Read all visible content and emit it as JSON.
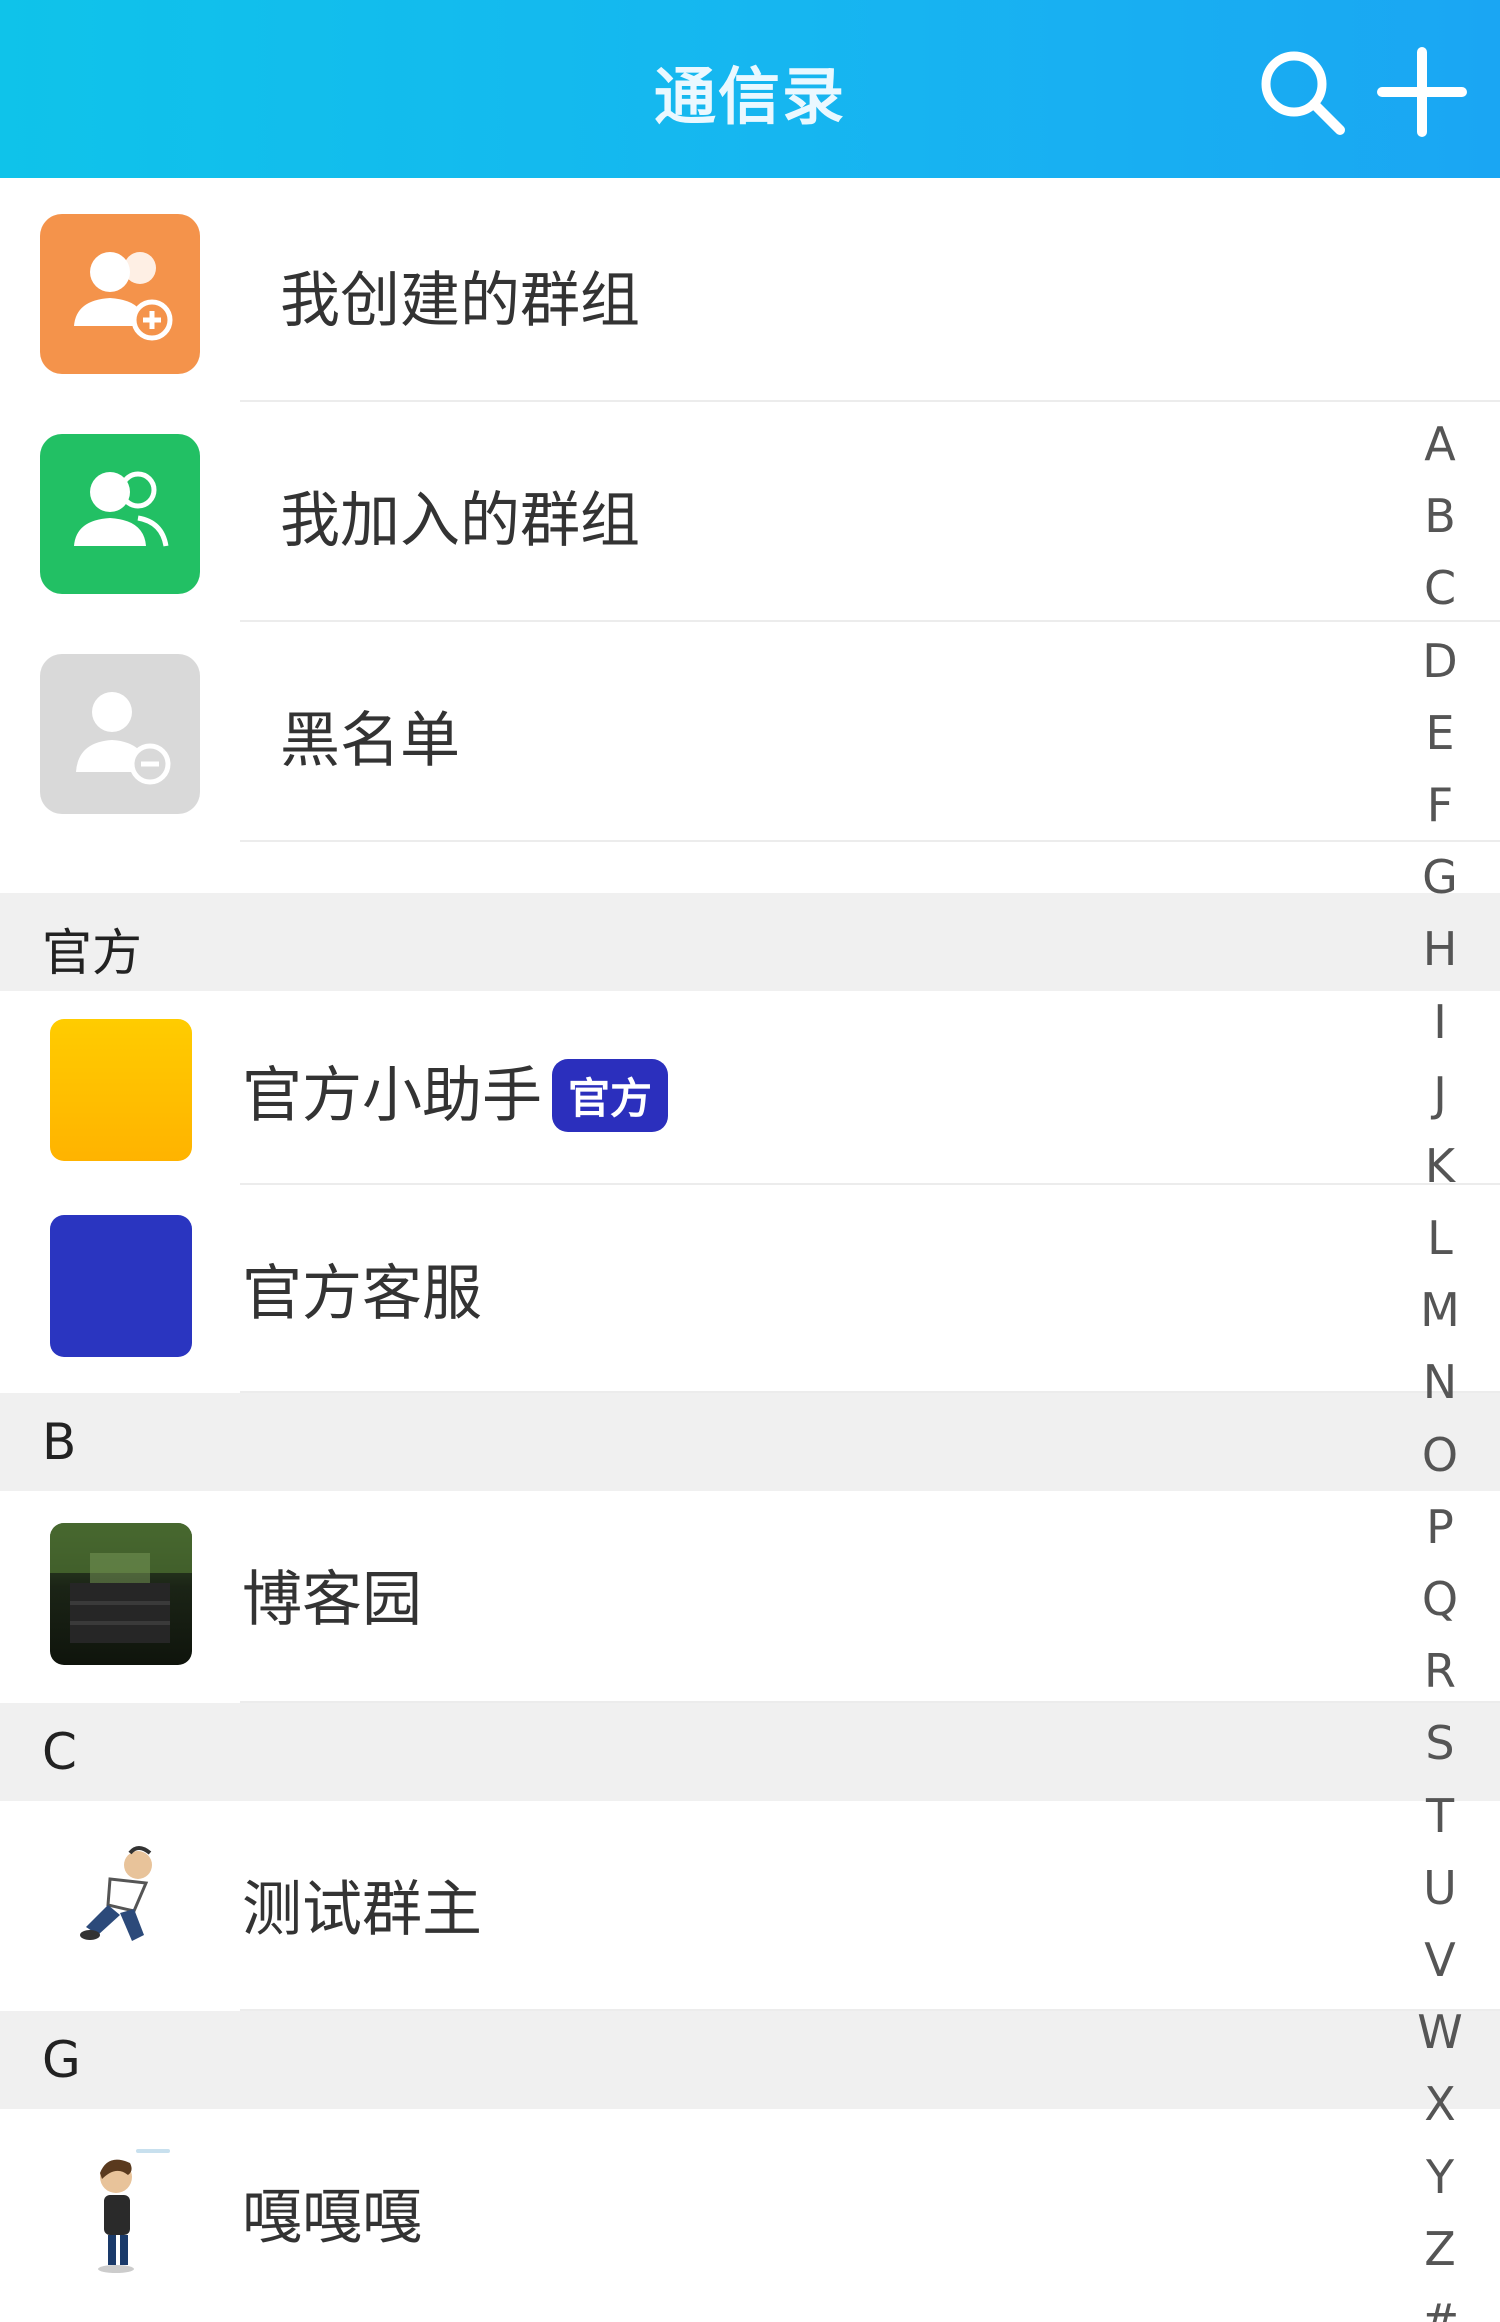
{
  "header": {
    "title": "通信录"
  },
  "menu": [
    {
      "label": "我创建的群组",
      "color": "#f4934b"
    },
    {
      "label": "我加入的群组",
      "color": "#22c064"
    },
    {
      "label": "黑名单",
      "color": "#d9d9d9"
    }
  ],
  "sections": [
    {
      "title": "官方",
      "contacts": [
        {
          "name": "官方小助手",
          "badge": "官方",
          "avatar_color": "#ffc107"
        },
        {
          "name": "官方客服",
          "avatar_color": "#2a35c0"
        }
      ]
    },
    {
      "title": "B",
      "contacts": [
        {
          "name": "博客园",
          "avatar_color": "#1f2a1c"
        }
      ]
    },
    {
      "title": "C",
      "contacts": [
        {
          "name": "测试群主",
          "avatar_color": "#ffffff"
        }
      ]
    },
    {
      "title": "G",
      "contacts": [
        {
          "name": "嘎嘎嘎",
          "avatar_color": "#ffffff"
        }
      ]
    }
  ],
  "index": [
    "A",
    "B",
    "C",
    "D",
    "E",
    "F",
    "G",
    "H",
    "I",
    "J",
    "K",
    "L",
    "M",
    "N",
    "O",
    "P",
    "Q",
    "R",
    "S",
    "T",
    "U",
    "V",
    "W",
    "X",
    "Y",
    "Z",
    "#"
  ]
}
